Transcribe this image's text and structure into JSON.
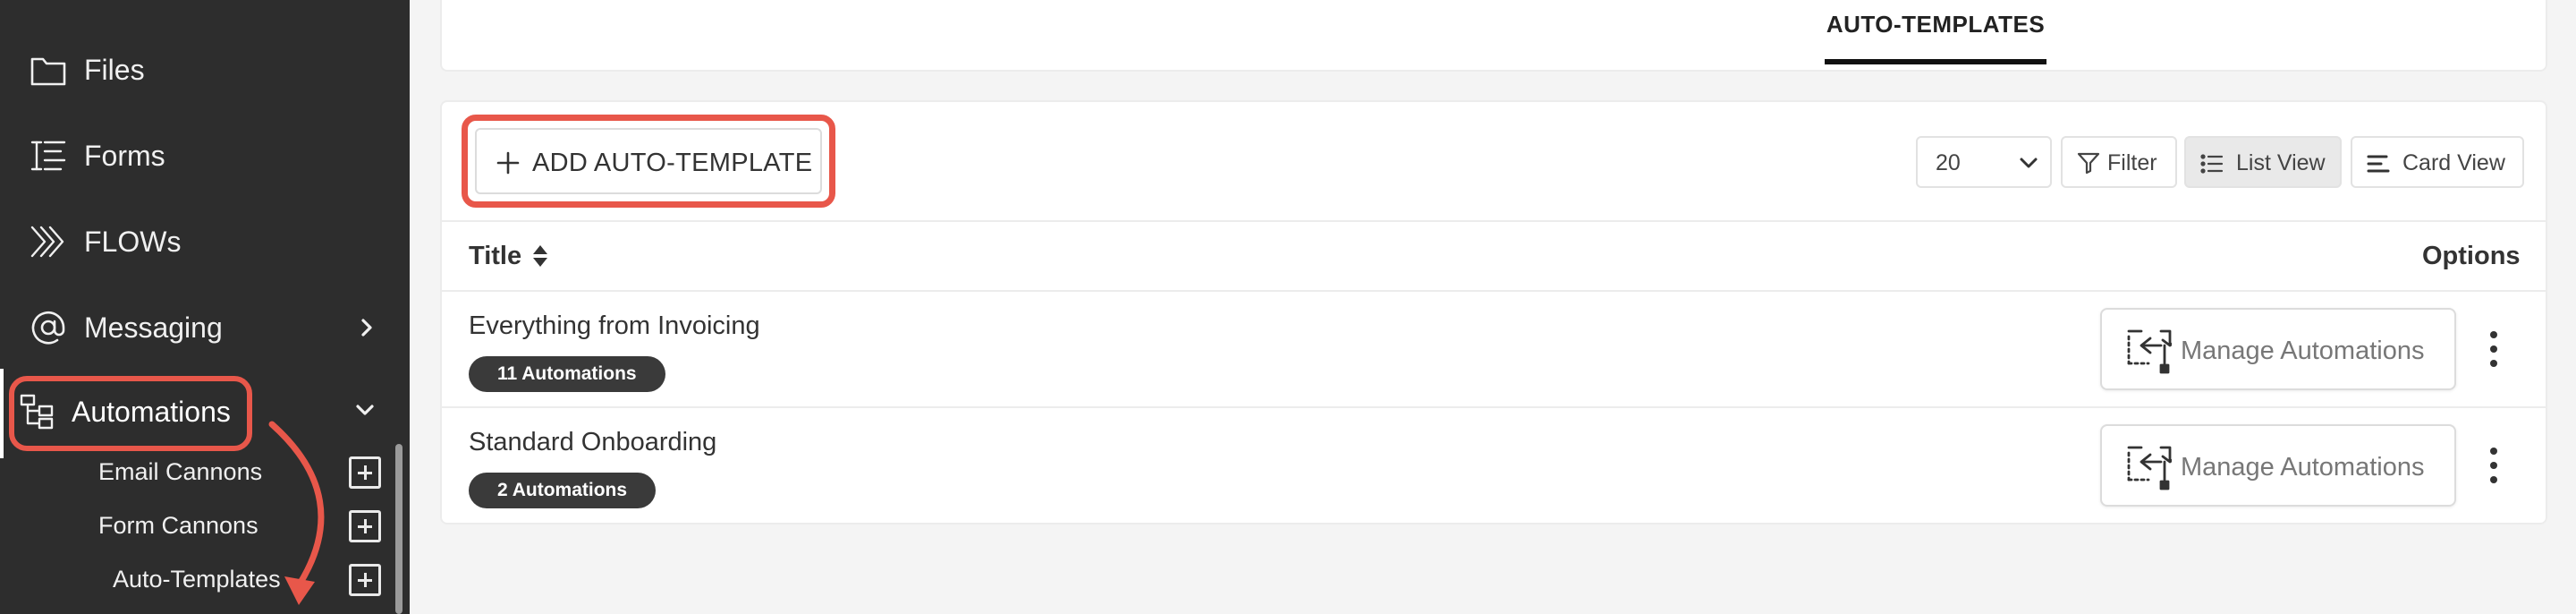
{
  "sidebar": {
    "items": [
      {
        "label": "Files",
        "icon": "folder-icon"
      },
      {
        "label": "Forms",
        "icon": "form-list-icon"
      },
      {
        "label": "FLOWs",
        "icon": "flows-chevrons-icon"
      },
      {
        "label": "Messaging",
        "icon": "at-sign-icon"
      },
      {
        "label": "Automations",
        "icon": "automations-tree-icon"
      }
    ],
    "sub_items": [
      {
        "label": "Email Cannons"
      },
      {
        "label": "Form Cannons"
      },
      {
        "label": "Auto-Templates"
      }
    ]
  },
  "tabs": [
    {
      "label": "AUTO-TEMPLATES",
      "active": true
    }
  ],
  "toolbar": {
    "add_label": "ADD AUTO-TEMPLATE",
    "page_size": "20",
    "filter_label": "Filter",
    "list_view_label": "List View",
    "card_view_label": "Card View"
  },
  "table": {
    "columns": [
      "Title",
      "Options"
    ],
    "rows": [
      {
        "title": "Everything from Invoicing",
        "badge": "11 Automations",
        "action": "Manage Automations"
      },
      {
        "title": "Standard Onboarding",
        "badge": "2 Automations",
        "action": "Manage Automations"
      }
    ]
  },
  "colors": {
    "sidebar_bg": "#2d2d2d",
    "highlight": "#e8574a",
    "badge_bg": "#3a3a3a",
    "page_bg": "#f4f4f4"
  }
}
